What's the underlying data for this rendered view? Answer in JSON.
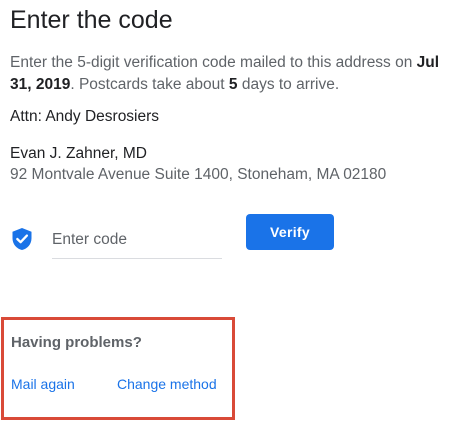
{
  "page": {
    "title": "Enter the code"
  },
  "instructions": {
    "prefix": "Enter the 5-digit verification code mailed to this address on ",
    "date": "Jul 31, 2019",
    "middle": ". Postcards take about ",
    "days": "5",
    "suffix": " days to arrive."
  },
  "address": {
    "attn": "Attn: Andy Desrosiers",
    "name": "Evan J. Zahner, MD",
    "street": "92 Montvale Avenue Suite 1400, Stoneham, MA 02180"
  },
  "verification": {
    "icon": "verified-shield-icon",
    "code_value": "",
    "code_placeholder": "Enter code",
    "verify_label": "Verify"
  },
  "problems": {
    "title": "Having problems?",
    "mail_again_label": "Mail again",
    "change_method_label": "Change method"
  },
  "colors": {
    "accent": "#1a73e8",
    "highlight_border": "#d94a38",
    "primary_text": "#202124",
    "secondary_text": "#5f6368"
  }
}
